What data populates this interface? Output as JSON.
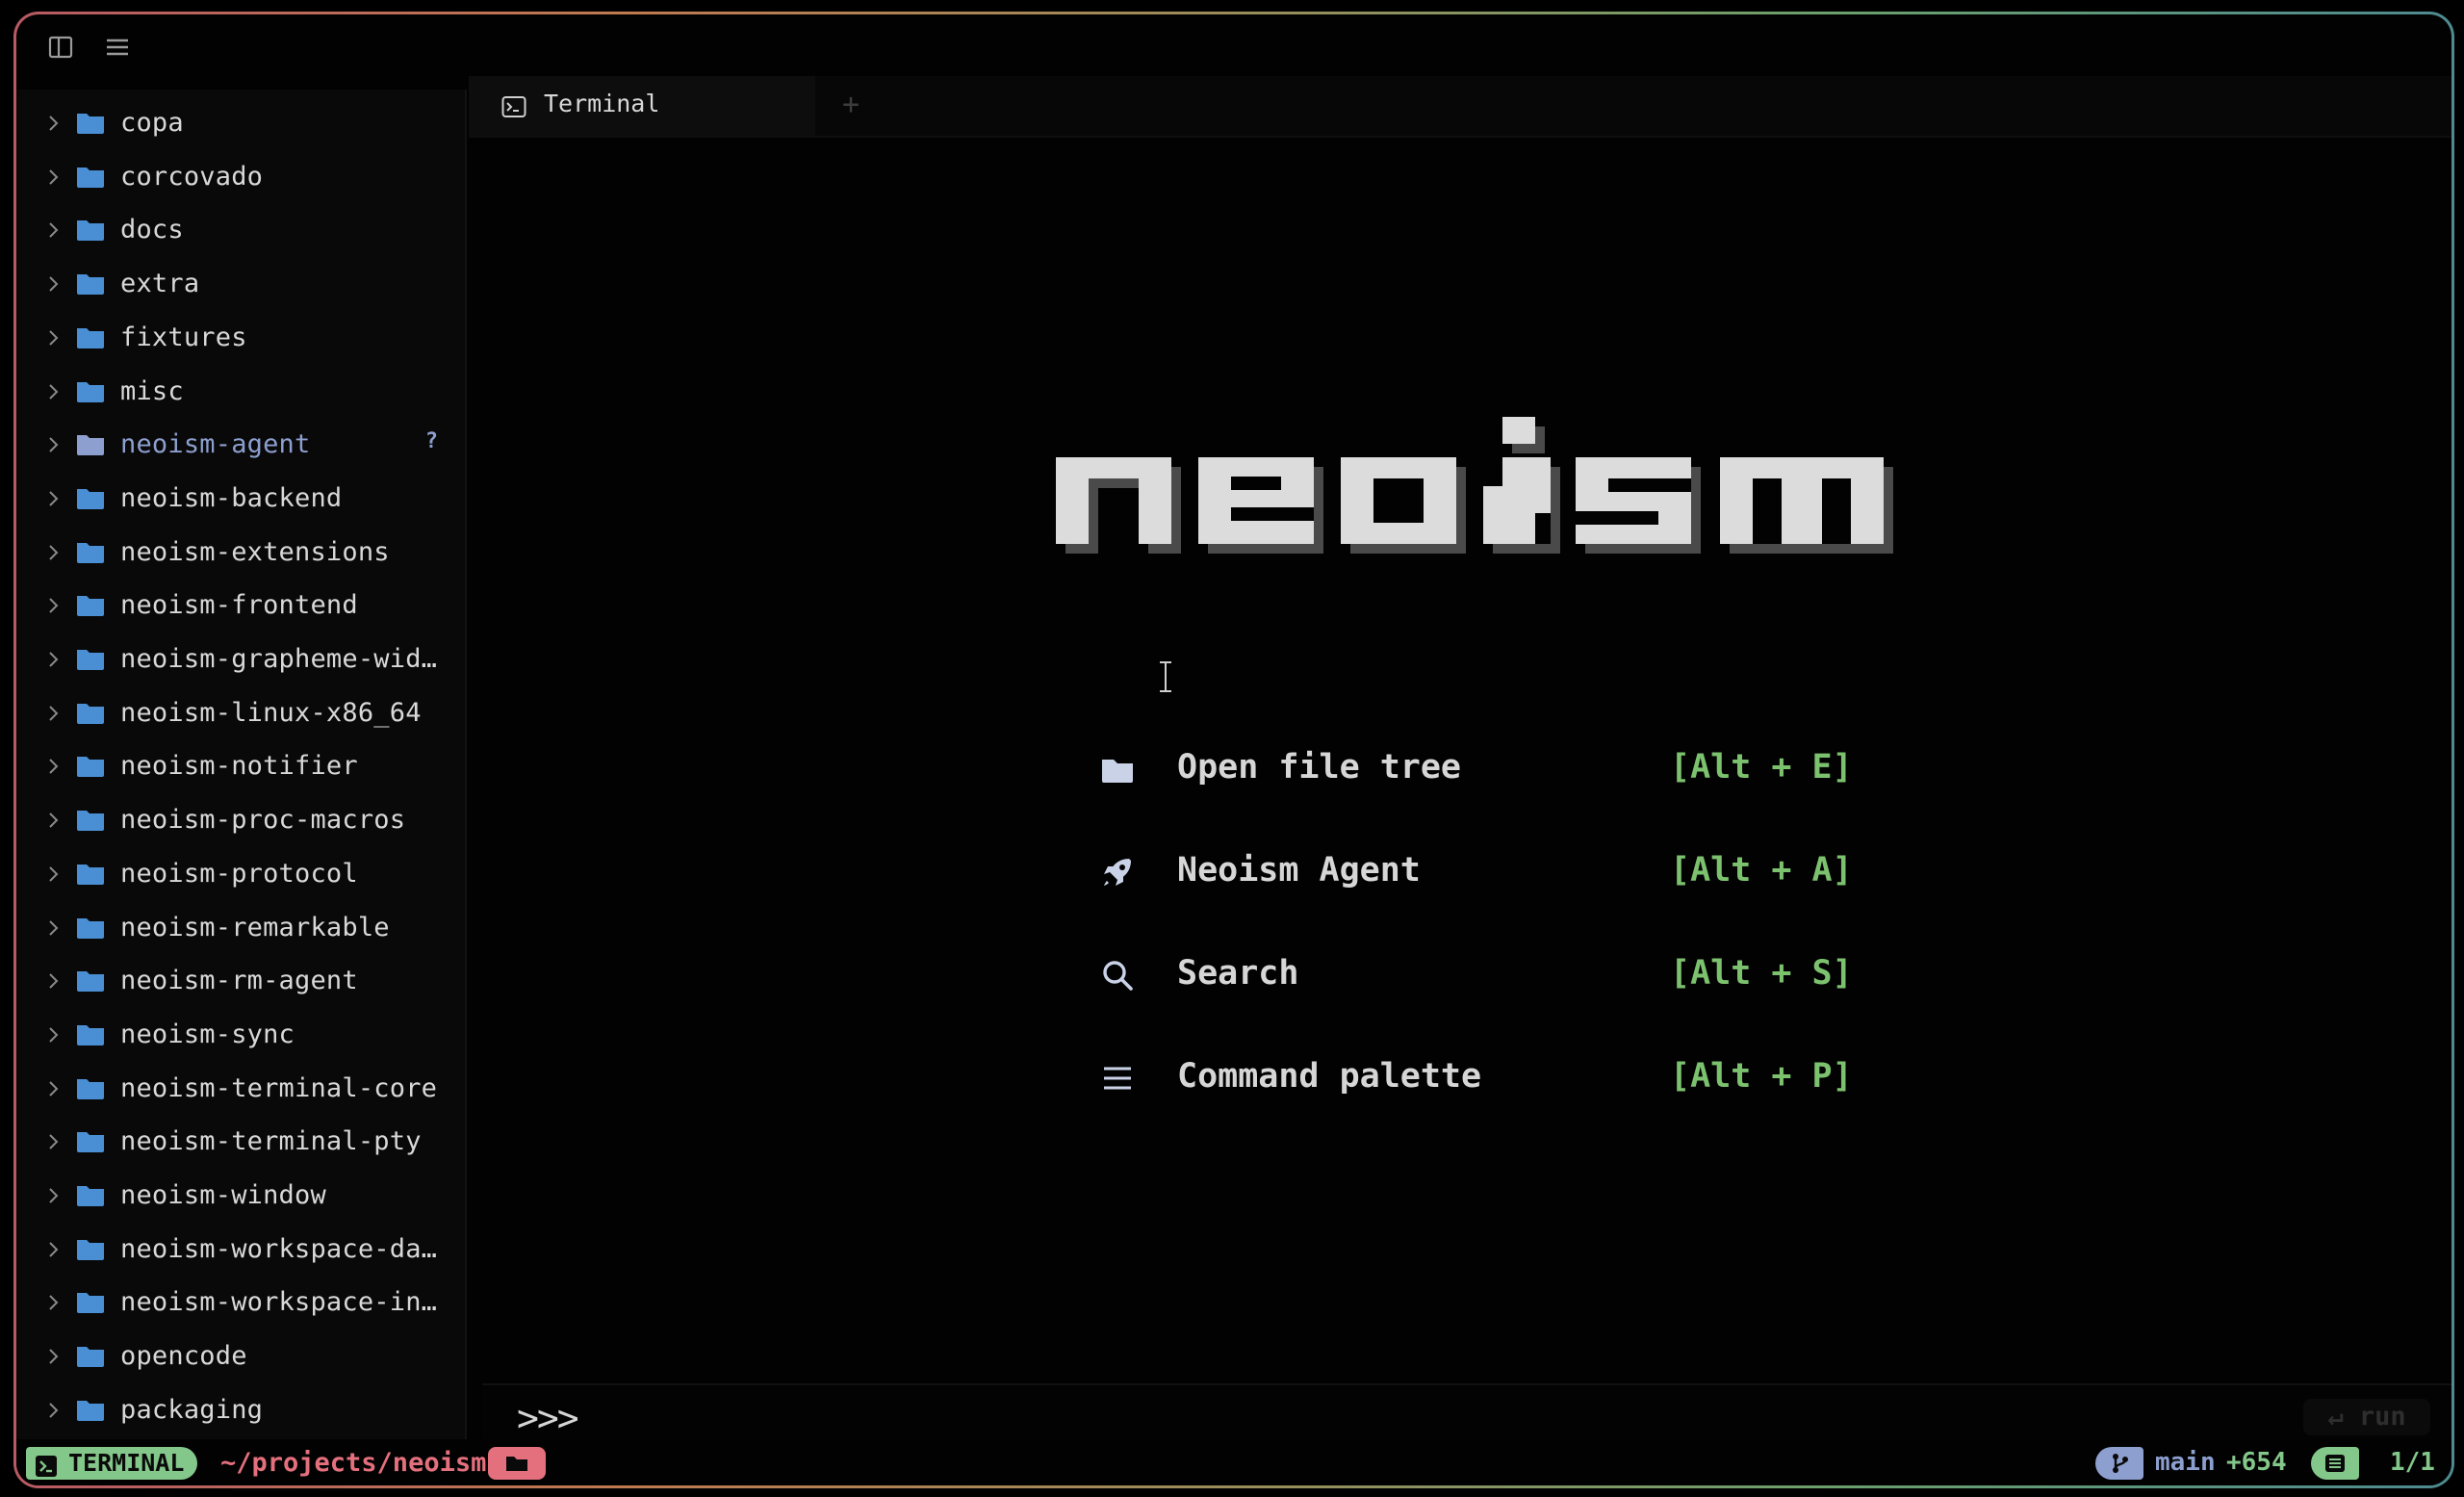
{
  "colors": {
    "folder": "#4a8fd4",
    "accent_green": "#7cc26e",
    "accent_pink": "#e4707d",
    "accent_blue": "#8d9fcf"
  },
  "topbar": {
    "icons": [
      "sidebar-toggle-icon",
      "hamburger-menu-icon"
    ]
  },
  "sidebar": {
    "items": [
      {
        "label": "copa"
      },
      {
        "label": "corcovado"
      },
      {
        "label": "docs"
      },
      {
        "label": "extra"
      },
      {
        "label": "fixtures"
      },
      {
        "label": "misc"
      },
      {
        "label": "neoism-agent",
        "status": "?"
      },
      {
        "label": "neoism-backend"
      },
      {
        "label": "neoism-extensions"
      },
      {
        "label": "neoism-frontend"
      },
      {
        "label": "neoism-grapheme-wid…"
      },
      {
        "label": "neoism-linux-x86_64"
      },
      {
        "label": "neoism-notifier"
      },
      {
        "label": "neoism-proc-macros"
      },
      {
        "label": "neoism-protocol"
      },
      {
        "label": "neoism-remarkable"
      },
      {
        "label": "neoism-rm-agent"
      },
      {
        "label": "neoism-sync"
      },
      {
        "label": "neoism-terminal-core"
      },
      {
        "label": "neoism-terminal-pty"
      },
      {
        "label": "neoism-window"
      },
      {
        "label": "neoism-workspace-da…"
      },
      {
        "label": "neoism-workspace-in…"
      },
      {
        "label": "opencode"
      },
      {
        "label": "packaging"
      }
    ]
  },
  "tabs": [
    {
      "label": "Terminal",
      "icon": "terminal-icon"
    }
  ],
  "add_tab": "+",
  "welcome": {
    "logo": "neoism",
    "menu": [
      {
        "icon": "folder-icon",
        "label": "Open file tree",
        "key": "[Alt + E]"
      },
      {
        "icon": "rocket-icon",
        "label": "Neoism Agent",
        "key": "[Alt + A]"
      },
      {
        "icon": "search-icon",
        "label": "Search",
        "key": "[Alt + S]"
      },
      {
        "icon": "list-icon",
        "label": "Command palette",
        "key": "[Alt + P]"
      }
    ]
  },
  "prompt": {
    "symbol": ">>>",
    "run_label": "↵ run"
  },
  "status": {
    "mode": "TERMINAL",
    "path": "~/projects/neoism",
    "branch": "main",
    "changes": "+654",
    "position": "1/1"
  }
}
